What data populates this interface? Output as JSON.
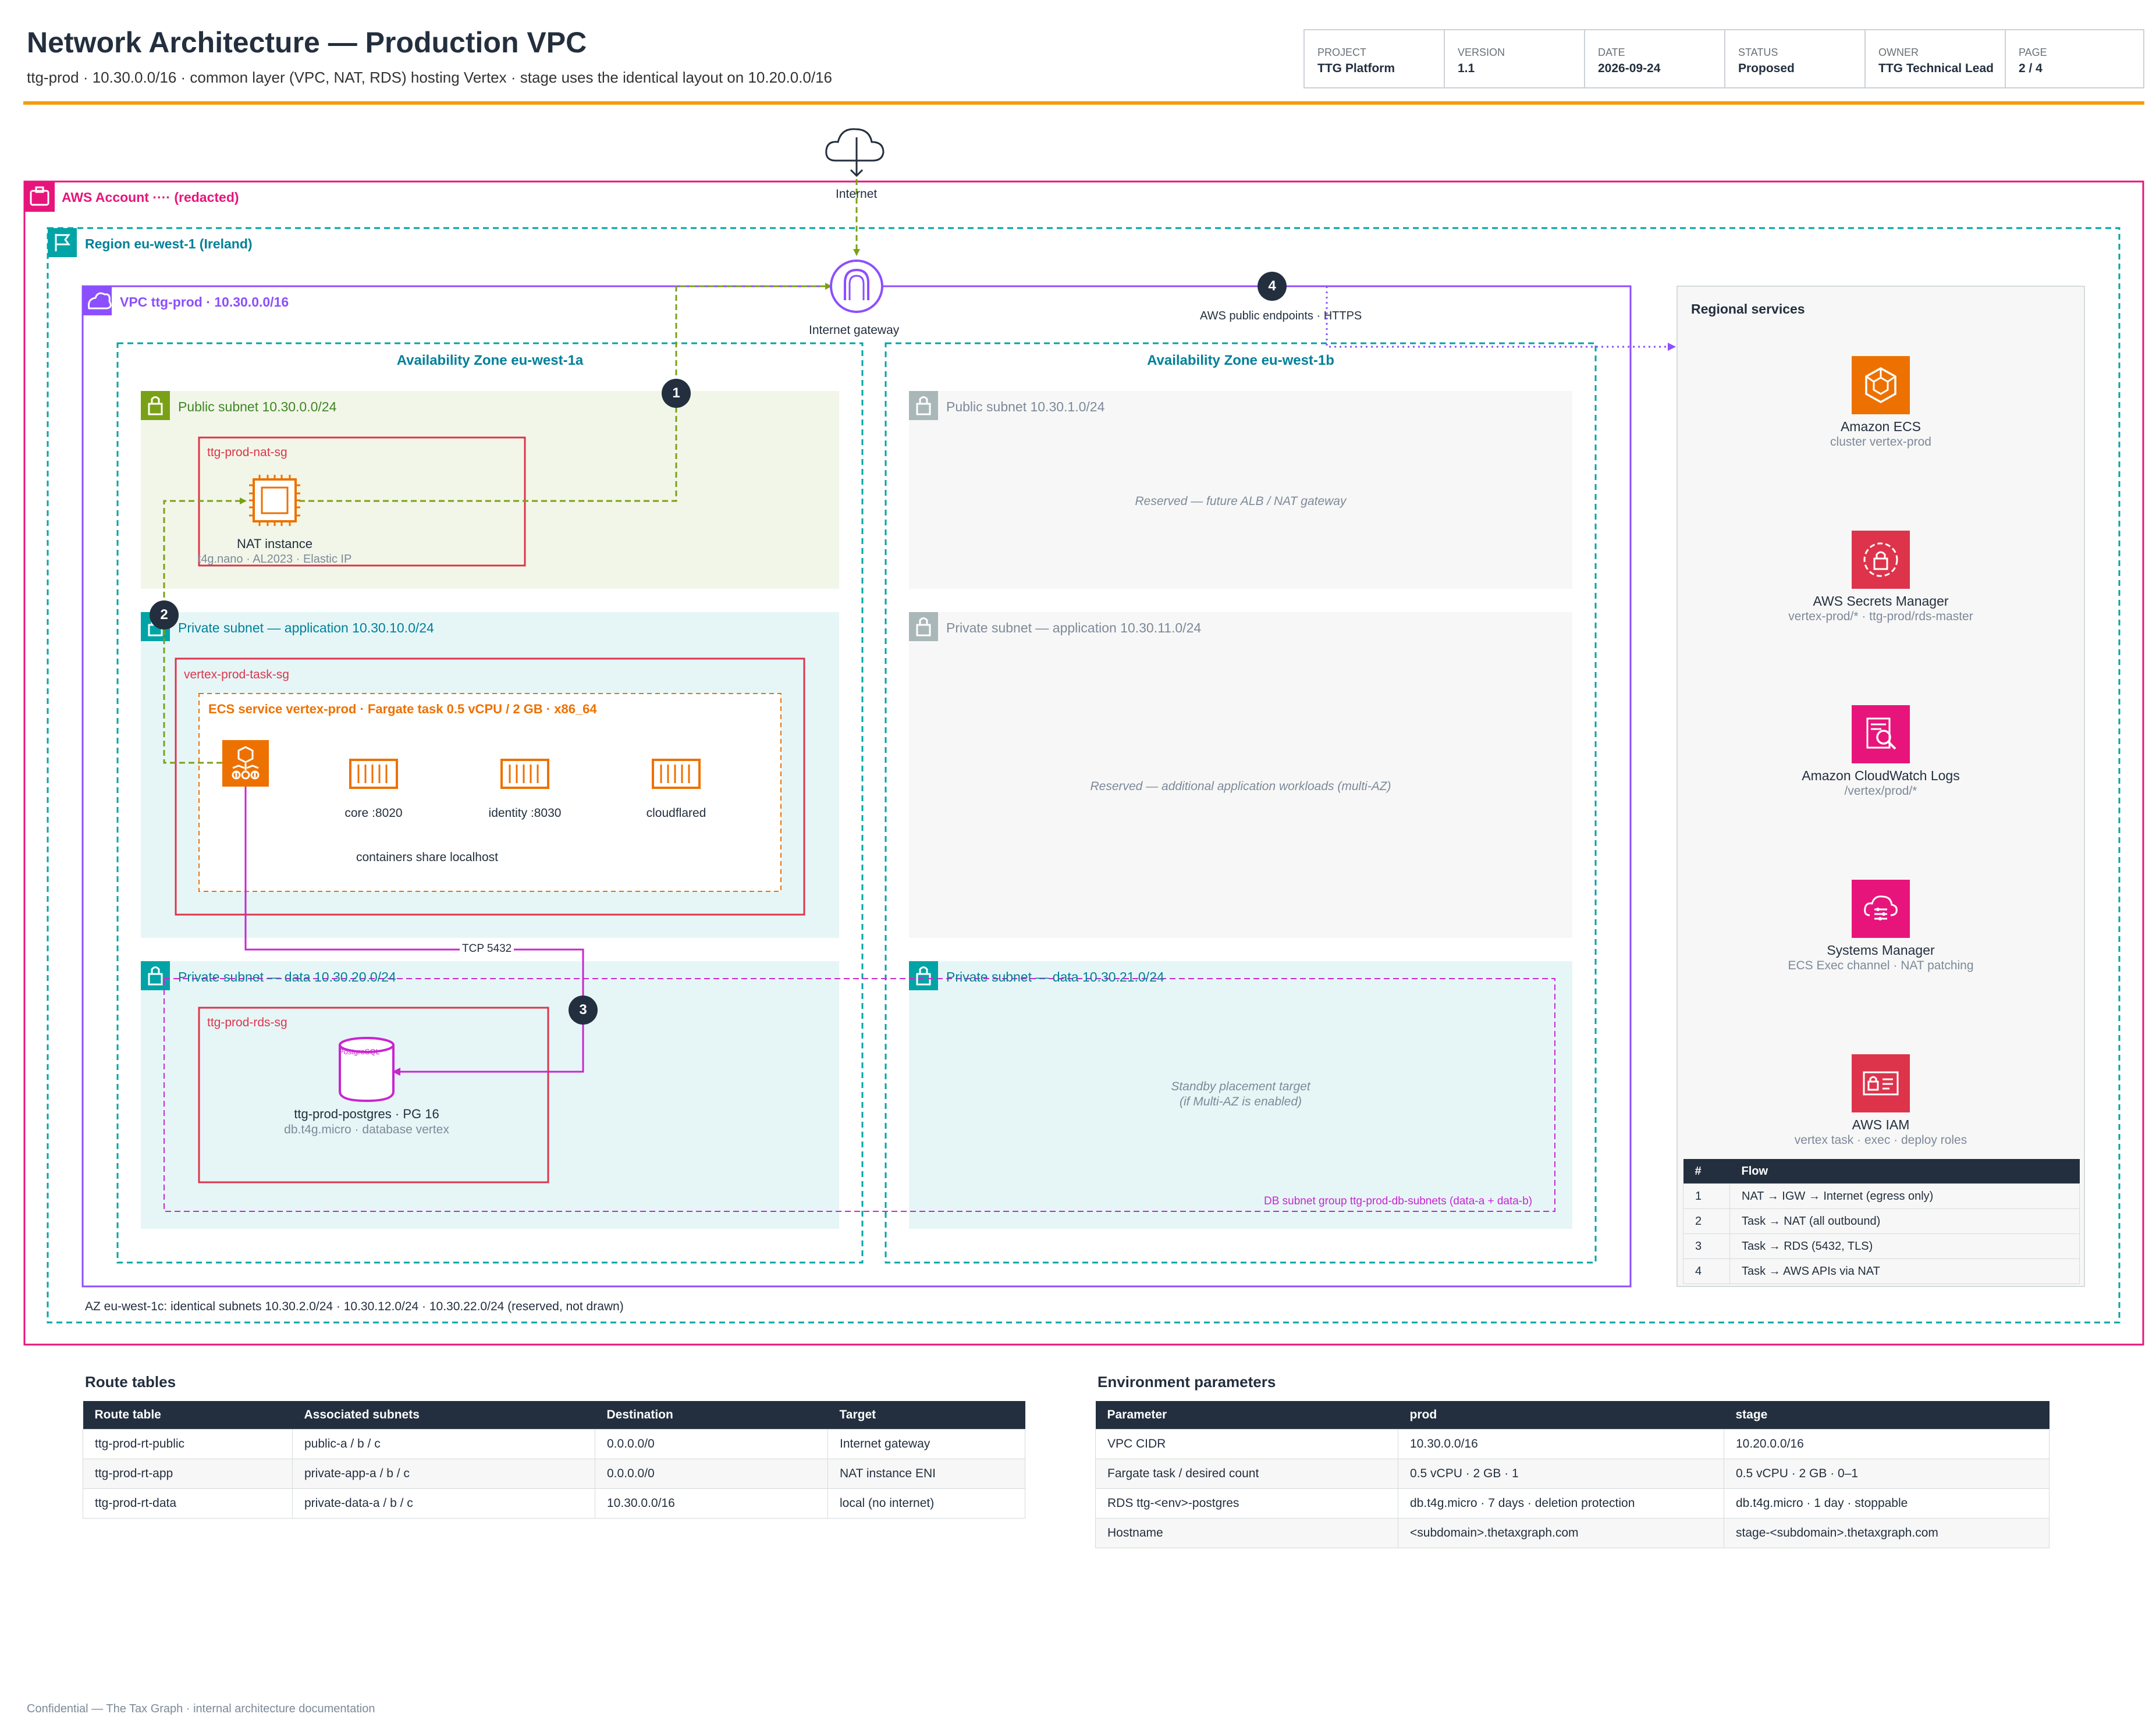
{
  "header": {
    "title": "Network Architecture — Production VPC",
    "subtitle": "ttg-prod · 10.30.0.0/16 · common layer (VPC, NAT, RDS) hosting Vertex · stage uses the identical layout on 10.20.0.0/16",
    "meta": [
      {
        "label": "PROJECT",
        "value": "TTG Platform"
      },
      {
        "label": "VERSION",
        "value": "1.1"
      },
      {
        "label": "DATE",
        "value": "2026-09-24"
      },
      {
        "label": "STATUS",
        "value": "Proposed"
      },
      {
        "label": "OWNER",
        "value": "TTG Technical Lead"
      },
      {
        "label": "PAGE",
        "value": "2 / 4"
      }
    ]
  },
  "diagram": {
    "internet_label": "Internet",
    "account_label": "AWS Account ···· (redacted)",
    "region_label": "Region eu-west-1 (Ireland)",
    "vpc_label": "VPC ttg-prod · 10.30.0.0/16",
    "igw_label": "Internet gateway",
    "endpoints_label": "AWS public endpoints · HTTPS",
    "az_a_label": "Availability Zone eu-west-1a",
    "az_b_label": "Availability Zone eu-west-1b",
    "public_a_label": "Public subnet 10.30.0.0/24",
    "public_b_label": "Public subnet 10.30.1.0/24",
    "public_b_note": "Reserved — future ALB / NAT gateway",
    "nat_sg_label": "ttg-prod-nat-sg",
    "nat_name": "NAT instance",
    "nat_desc": "t4g.nano · AL2023 · Elastic IP",
    "app_a_label": "Private subnet — application 10.30.10.0/24",
    "app_b_label": "Private subnet — application 10.30.11.0/24",
    "app_b_note": "Reserved — additional application workloads (multi-AZ)",
    "task_sg_label": "vertex-prod-task-sg",
    "ecs_service_label": "ECS service vertex-prod · Fargate task 0.5 vCPU / 2 GB · x86_64",
    "containers": [
      {
        "name": "core :8020"
      },
      {
        "name": "identity :8030"
      },
      {
        "name": "cloudflared"
      }
    ],
    "containers_note": "containers share localhost",
    "tcp_label": "TCP 5432",
    "data_a_label": "Private subnet — data 10.30.20.0/24",
    "data_b_label": "Private subnet — data 10.30.21.0/24",
    "data_b_note_1": "Standby placement target",
    "data_b_note_2": "(if Multi-AZ is enabled)",
    "rds_sg_label": "ttg-prod-rds-sg",
    "rds_name": "ttg-prod-postgres · PG 16",
    "rds_desc": "db.t4g.micro · database vertex",
    "pg_icon_text": "PostgreSQL",
    "db_subnet_group_label": "DB subnet group ttg-prod-db-subnets (data-a + data-b)",
    "az_c_note": "AZ eu-west-1c: identical subnets 10.30.2.0/24 · 10.30.12.0/24 · 10.30.22.0/24 (reserved, not drawn)",
    "badges": [
      "1",
      "2",
      "3",
      "4"
    ]
  },
  "regional": {
    "title": "Regional services",
    "services": [
      {
        "name": "Amazon ECS",
        "desc": "cluster vertex-prod",
        "icon": "ecs-icon",
        "color": "#ed7100"
      },
      {
        "name": "AWS Secrets Manager",
        "desc": "vertex-prod/* · ttg-prod/rds-master",
        "icon": "secrets-manager-icon",
        "color": "#dd344c"
      },
      {
        "name": "Amazon CloudWatch Logs",
        "desc": "/vertex/prod/*",
        "icon": "cloudwatch-logs-icon",
        "color": "#e7157b"
      },
      {
        "name": "Systems Manager",
        "desc": "ECS Exec channel · NAT patching",
        "icon": "systems-manager-icon",
        "color": "#e7157b"
      },
      {
        "name": "AWS IAM",
        "desc": "vertex task · exec · deploy roles",
        "icon": "iam-icon",
        "color": "#dd344c"
      }
    ],
    "flows_header": [
      "#",
      "Flow"
    ],
    "flows": [
      [
        "1",
        "NAT → IGW → Internet (egress only)"
      ],
      [
        "2",
        "Task → NAT (all outbound)"
      ],
      [
        "3",
        "Task → RDS (5432, TLS)"
      ],
      [
        "4",
        "Task → AWS APIs via NAT"
      ]
    ]
  },
  "route_tables": {
    "title": "Route tables",
    "headers": [
      "Route table",
      "Associated subnets",
      "Destination",
      "Target"
    ],
    "rows": [
      [
        "ttg-prod-rt-public",
        "public-a / b / c",
        "0.0.0.0/0",
        "Internet gateway"
      ],
      [
        "ttg-prod-rt-app",
        "private-app-a / b / c",
        "0.0.0.0/0",
        "NAT instance ENI"
      ],
      [
        "ttg-prod-rt-data",
        "private-data-a / b / c",
        "10.30.0.0/16",
        "local (no internet)"
      ]
    ]
  },
  "env_params": {
    "title": "Environment parameters",
    "headers": [
      "Parameter",
      "prod",
      "stage"
    ],
    "rows": [
      [
        "VPC CIDR",
        "10.30.0.0/16",
        "10.20.0.0/16"
      ],
      [
        "Fargate task / desired count",
        "0.5 vCPU · 2 GB · 1",
        "0.5 vCPU · 2 GB · 0–1"
      ],
      [
        "RDS ttg-<env>-postgres",
        "db.t4g.micro · 7 days · deletion protection",
        "db.t4g.micro · 1 day · stoppable"
      ],
      [
        "Hostname",
        "<subdomain>.thetaxgraph.com",
        "stage-<subdomain>.thetaxgraph.com"
      ]
    ]
  },
  "footer": "Confidential — The Tax Graph · internal architecture documentation"
}
